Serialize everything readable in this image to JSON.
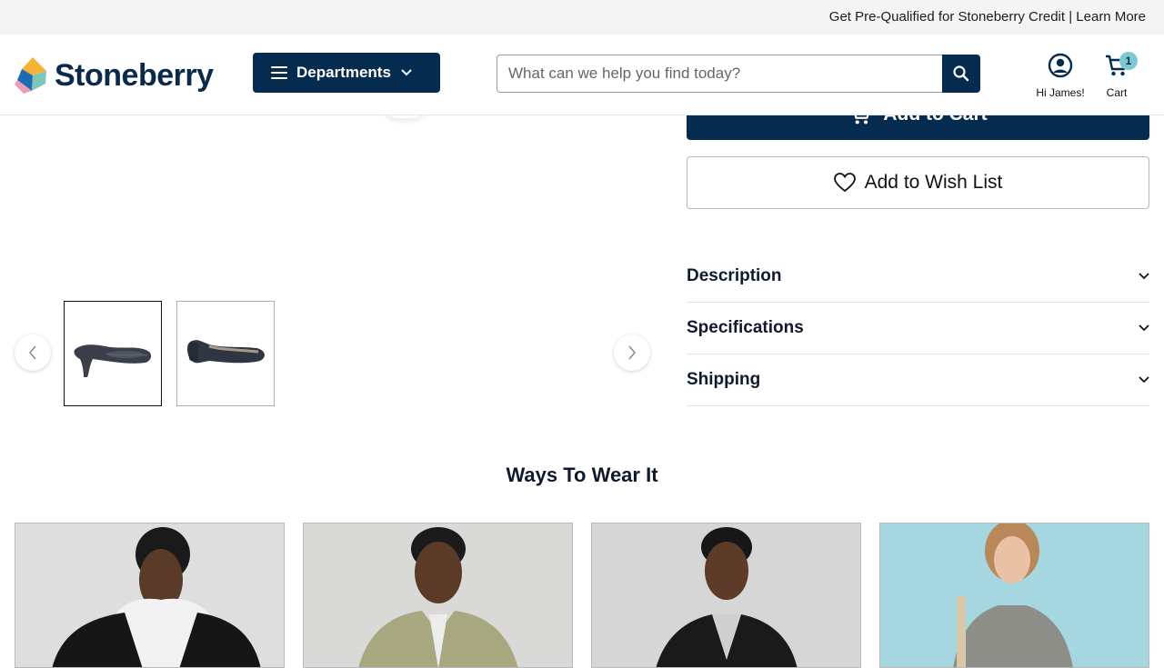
{
  "promo": {
    "text": "Get Pre-Qualified for Stoneberry Credit | Learn More"
  },
  "header": {
    "logo_text": "Stoneberry",
    "departments_label": "Departments",
    "search_placeholder": "What can we help you find today?",
    "account_label": "Hi James!",
    "cart_label": "Cart",
    "cart_count": "1"
  },
  "product": {
    "add_to_cart_label": "Add to Cart",
    "wishlist_label": "Add to Wish List",
    "accordion": [
      {
        "label": "Description"
      },
      {
        "label": "Specifications"
      },
      {
        "label": "Shipping"
      }
    ]
  },
  "ways": {
    "title": "Ways To Wear It"
  },
  "colors": {
    "navy": "#052b4e",
    "badge": "#7ec8d3"
  }
}
